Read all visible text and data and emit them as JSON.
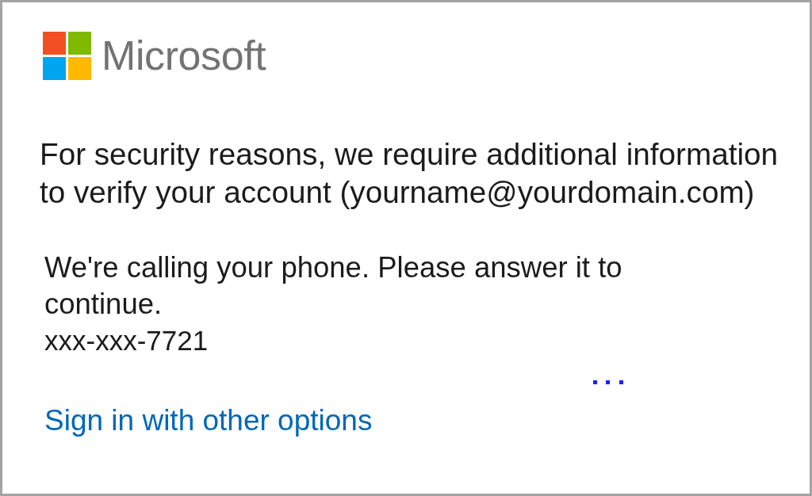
{
  "logo": {
    "wordmark": "Microsoft"
  },
  "heading": "For security reasons, we require additional information to verify your account (yourname@yourdomain.com)",
  "call_status": {
    "message": "We're calling your phone. Please answer it to continue.",
    "phone": "xxx-xxx-7721"
  },
  "link": "Sign in with other options"
}
